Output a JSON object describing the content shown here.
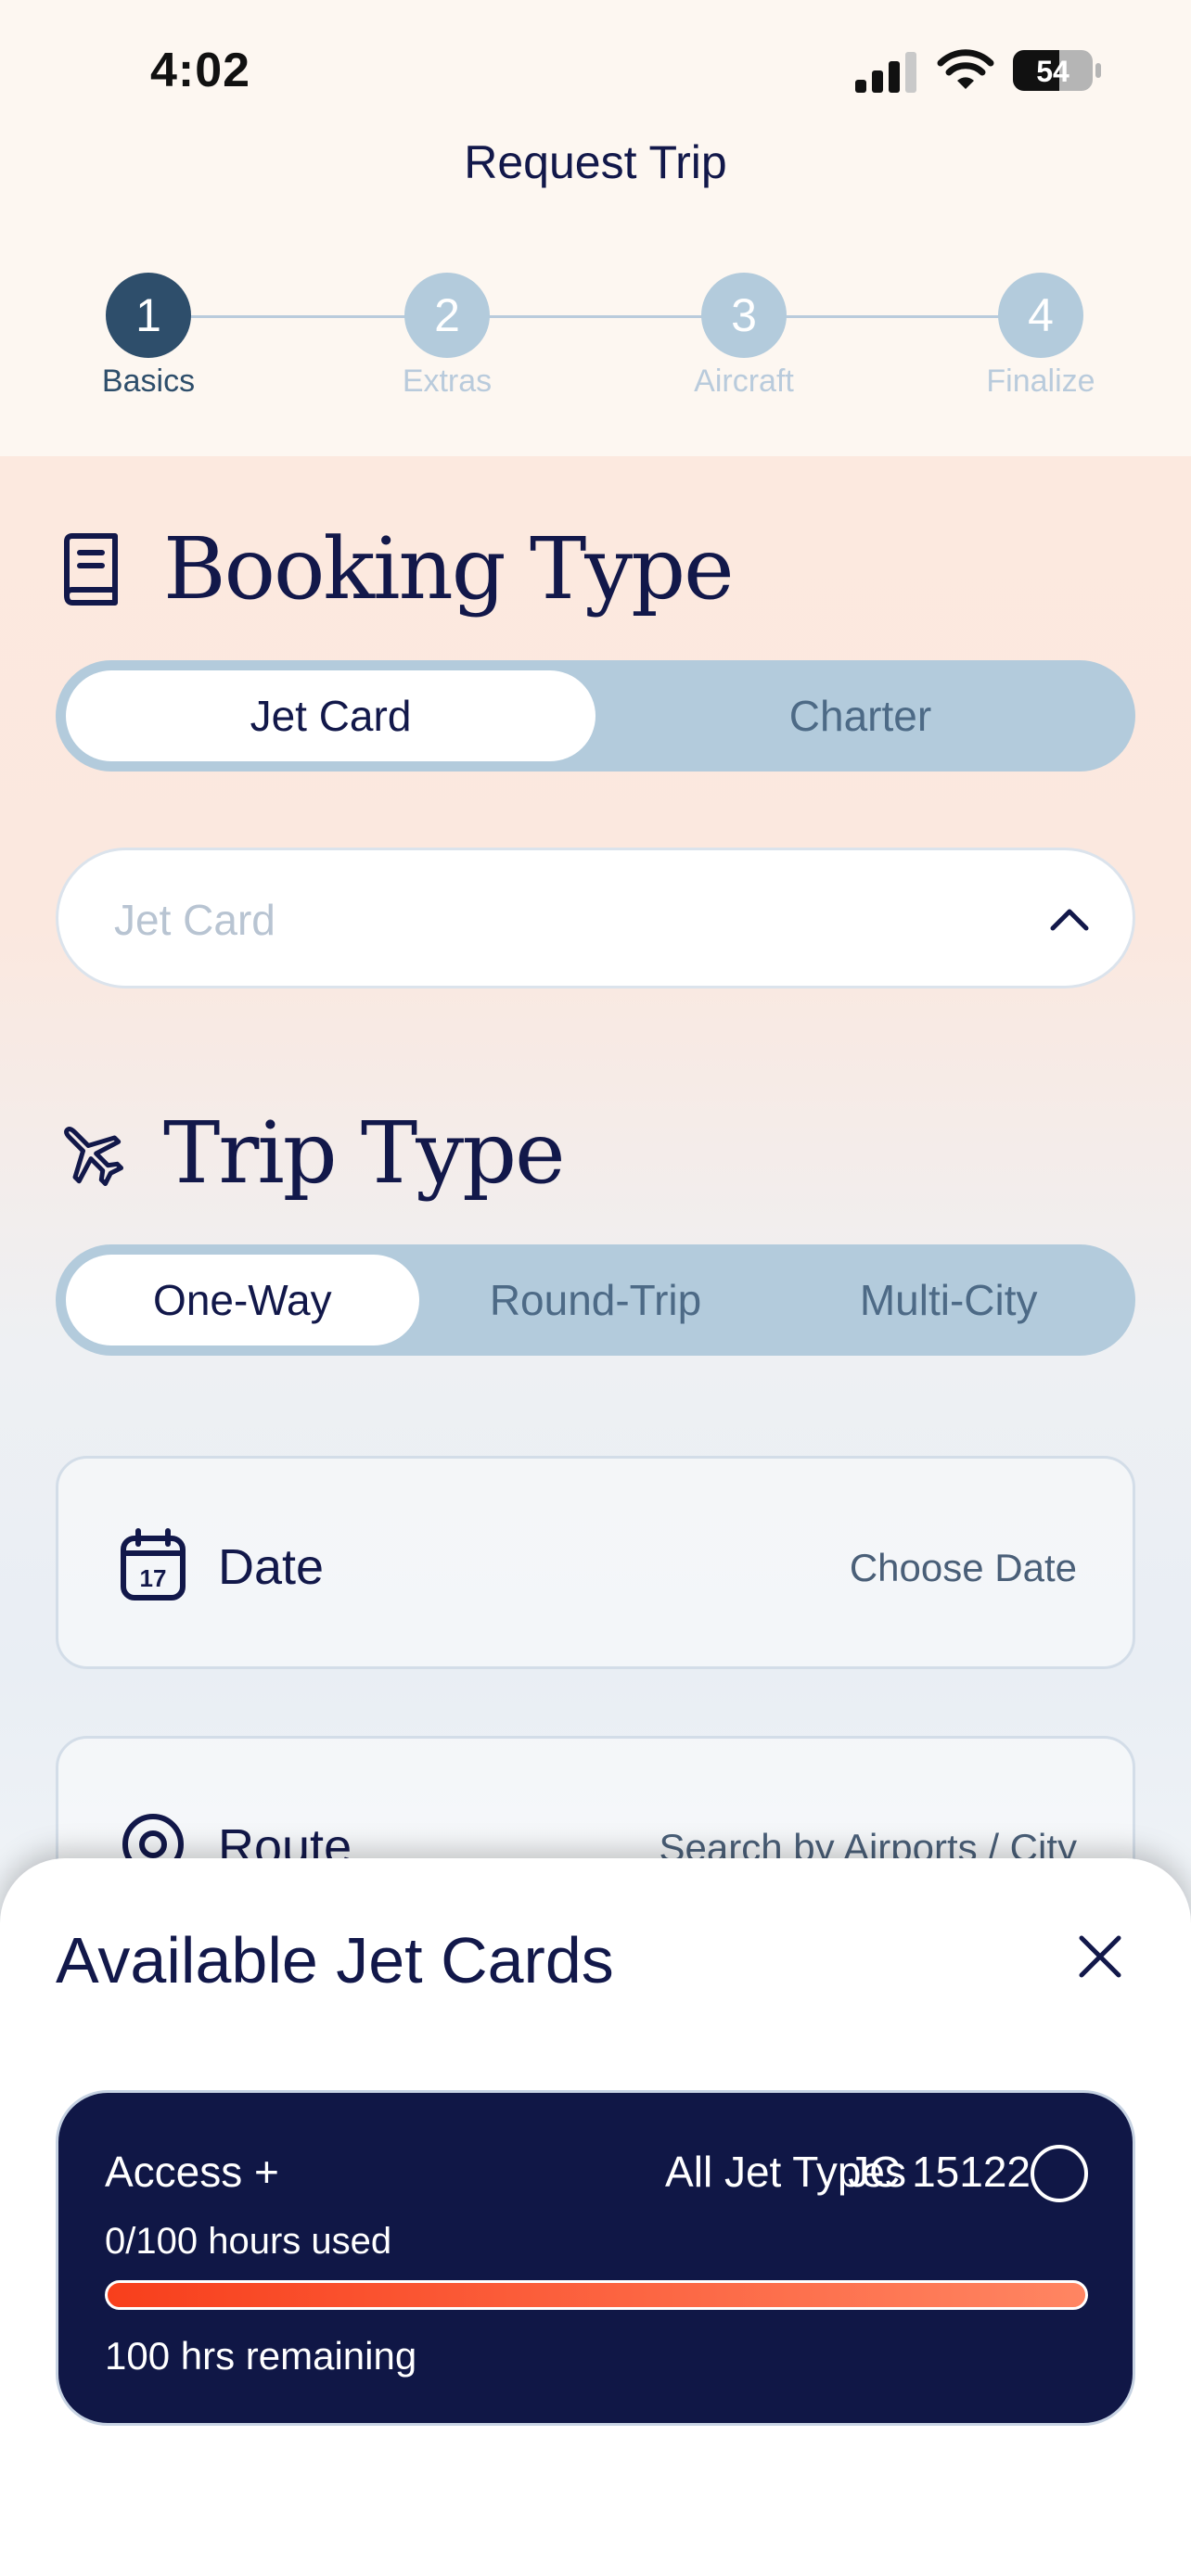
{
  "status_bar": {
    "time": "4:02",
    "battery": "54"
  },
  "nav": {
    "title": "Request Trip"
  },
  "stepper": {
    "steps": [
      {
        "number": "1",
        "label": "Basics",
        "active": true
      },
      {
        "number": "2",
        "label": "Extras",
        "active": false
      },
      {
        "number": "3",
        "label": "Aircraft",
        "active": false
      },
      {
        "number": "4",
        "label": "Finalize",
        "active": false
      }
    ]
  },
  "booking": {
    "heading": "Booking Type",
    "icon": "book-icon",
    "options": [
      "Jet Card",
      "Charter"
    ],
    "selected": "Jet Card",
    "select_placeholder": "Jet Card"
  },
  "trip": {
    "heading": "Trip Type",
    "icon": "airplane-icon",
    "options": [
      "One-Way",
      "Round-Trip",
      "Multi-City"
    ],
    "selected": "One-Way",
    "date_label": "Date",
    "date_value": "Choose Date",
    "route_label": "Route",
    "route_value": "Search by Airports / City"
  },
  "sheet": {
    "title": "Available Jet Cards",
    "cards": [
      {
        "name": "Access +",
        "jet_types": "All Jet Types",
        "card_id": "JC 15122",
        "used": "0/100 hours used",
        "remaining": "100 hrs remaining",
        "used_fraction": 0.0
      }
    ]
  },
  "colors": {
    "navy": "#101746",
    "accent_start": "#f83f1c",
    "accent_end": "#ff8562",
    "step_active": "#2e4e6b",
    "step_inactive": "#b3cbdc"
  }
}
